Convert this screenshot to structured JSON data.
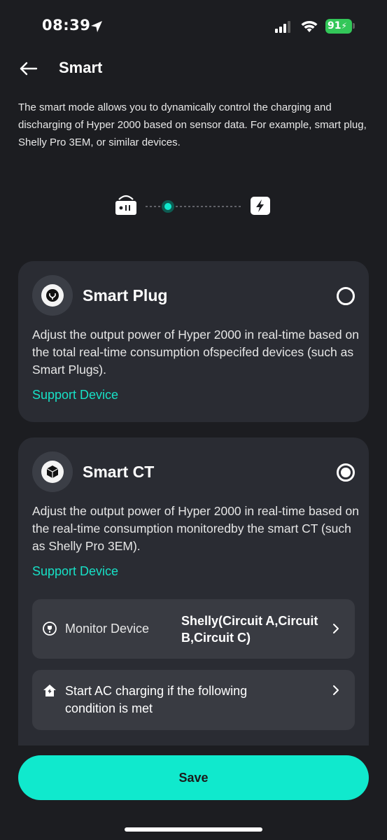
{
  "status_bar": {
    "time": "08:39",
    "battery": "91"
  },
  "header": {
    "title": "Smart"
  },
  "intro": {
    "text": "The smart mode allows you to dynamically control the charging and discharging of Hyper 2000 based on sensor data. For example, smart plug, Shelly Pro 3EM, or similar devices."
  },
  "options": {
    "smart_plug": {
      "title": "Smart Plug",
      "description": "Adjust the output power of Hyper 2000 in real-time based on the total real-time consumption ofspecifed devices (such as Smart Plugs).",
      "link": "Support Device",
      "selected": false
    },
    "smart_ct": {
      "title": "Smart CT",
      "description": "Adjust the output power of Hyper 2000 in real-time based on the real-time consumption monitoredby the smart CT (such as Shelly Pro 3EM).",
      "link": "Support Device",
      "selected": true,
      "monitor_device": {
        "label": "Monitor Device",
        "value": "Shelly(Circuit A,Circuit B,Circuit C)"
      },
      "ac_charging": {
        "label": "Start AC charging if the following condition is met"
      }
    }
  },
  "actions": {
    "save_label": "Save"
  },
  "colors": {
    "background": "#1c1d21",
    "card": "#2a2c33",
    "row": "#393b42",
    "accent": "#10e9cd",
    "link": "#17e0c6",
    "battery": "#33c759"
  },
  "icons": {
    "location": "location-arrow-icon",
    "signal": "cellular-signal-icon",
    "wifi": "wifi-icon",
    "back": "arrow-left-icon",
    "device": "battery-device-icon",
    "node": "active-flow-node-icon",
    "power": "lightning-bolt-icon",
    "plug": "plug-icon",
    "ct": "cube-icon",
    "monitor": "monitor-plug-icon",
    "home": "house-plug-icon",
    "chevron": "chevron-right-icon"
  }
}
